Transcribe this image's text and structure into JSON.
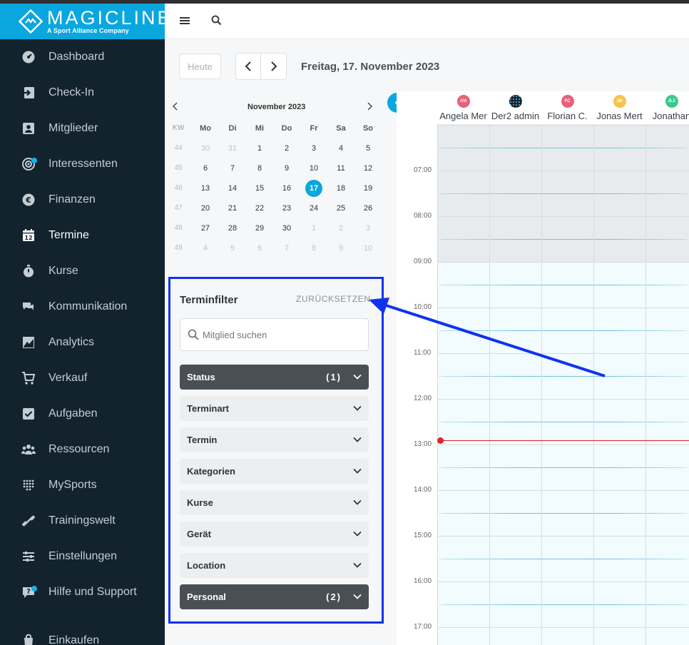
{
  "brand": {
    "name": "MAGICLINE",
    "subtitle": "A Sport Alliance Company"
  },
  "sidebar": {
    "items": [
      {
        "label": "Dashboard",
        "icon": "dashboard-icon"
      },
      {
        "label": "Check-In",
        "icon": "check-in-icon"
      },
      {
        "label": "Mitglieder",
        "icon": "members-icon"
      },
      {
        "label": "Interessenten",
        "icon": "prospects-icon"
      },
      {
        "label": "Finanzen",
        "icon": "finance-icon"
      },
      {
        "label": "Termine",
        "icon": "calendar-icon"
      },
      {
        "label": "Kurse",
        "icon": "stopwatch-icon"
      },
      {
        "label": "Kommunikation",
        "icon": "chat-icon"
      },
      {
        "label": "Analytics",
        "icon": "chart-icon"
      },
      {
        "label": "Verkauf",
        "icon": "cart-icon"
      },
      {
        "label": "Aufgaben",
        "icon": "task-icon"
      },
      {
        "label": "Ressourcen",
        "icon": "people-icon"
      },
      {
        "label": "MySports",
        "icon": "dots-grid-icon"
      },
      {
        "label": "Trainingswelt",
        "icon": "dumbbell-icon"
      },
      {
        "label": "Einstellungen",
        "icon": "sliders-icon"
      },
      {
        "label": "Hilfe und Support",
        "icon": "help-icon"
      },
      {
        "label": "Einkaufen",
        "icon": "shopping-icon"
      }
    ]
  },
  "toolbar": {
    "today": "Heute",
    "date": "Freitag, 17. November 2023"
  },
  "mini_calendar": {
    "title": "November 2023",
    "weekday_headers": [
      "KW",
      "Mo",
      "Di",
      "Mi",
      "Do",
      "Fr",
      "Sa",
      "So"
    ],
    "weeks": [
      {
        "kw": "44",
        "days": [
          "30",
          "31",
          "1",
          "2",
          "3",
          "4",
          "5"
        ]
      },
      {
        "kw": "45",
        "days": [
          "6",
          "7",
          "8",
          "9",
          "10",
          "11",
          "12"
        ]
      },
      {
        "kw": "46",
        "days": [
          "13",
          "14",
          "15",
          "16",
          "17",
          "18",
          "19"
        ]
      },
      {
        "kw": "47",
        "days": [
          "20",
          "21",
          "22",
          "23",
          "24",
          "25",
          "26"
        ]
      },
      {
        "kw": "48",
        "days": [
          "27",
          "28",
          "29",
          "30",
          "1",
          "2",
          "3"
        ]
      },
      {
        "kw": "49",
        "days": [
          "4",
          "5",
          "6",
          "7",
          "8",
          "9",
          "10"
        ]
      }
    ],
    "selected": "17"
  },
  "filter": {
    "title": "Terminfilter",
    "reset": "ZURÜCKSETZEN",
    "search_placeholder": "Mitglied suchen",
    "sections": [
      {
        "label": "Status",
        "count": "(1)"
      },
      {
        "label": "Terminart",
        "count": ""
      },
      {
        "label": "Termin",
        "count": ""
      },
      {
        "label": "Kategorien",
        "count": ""
      },
      {
        "label": "Kurse",
        "count": ""
      },
      {
        "label": "Gerät",
        "count": ""
      },
      {
        "label": "Location",
        "count": ""
      },
      {
        "label": "Personal",
        "count": "(2)"
      }
    ]
  },
  "calendar": {
    "resources": [
      {
        "initials": "AM",
        "name": "Angela Mer",
        "color": "#e8607a"
      },
      {
        "initials": "",
        "name": "Der2 admin",
        "color": "#1b1f24"
      },
      {
        "initials": "FC",
        "name": "Florian C.",
        "color": "#e8607a"
      },
      {
        "initials": "JM",
        "name": "Jonas Mert",
        "color": "#f5c34e"
      },
      {
        "initials": "JL2",
        "name": "Jonathan",
        "color": "#3cc88a"
      }
    ],
    "times": [
      "07:00",
      "08:00",
      "09:00",
      "10:00",
      "11:00",
      "12:00",
      "13:00",
      "14:00",
      "15:00",
      "16:00",
      "17:00"
    ]
  },
  "colors": {
    "accent": "#0aa7df",
    "sidebar": "#12232e",
    "highlight_box": "#1032f0",
    "now_line": "#e0212a"
  }
}
